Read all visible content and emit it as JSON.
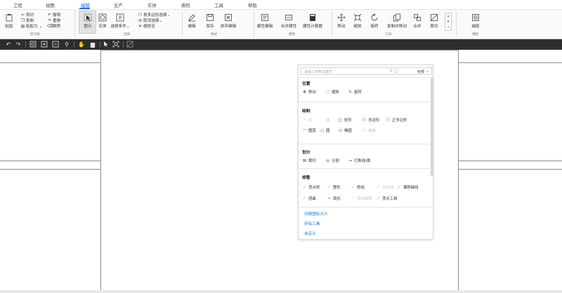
{
  "menubar": {
    "items": [
      {
        "label": "工程"
      },
      {
        "label": "视图"
      },
      {
        "label": "编辑"
      },
      {
        "label": "生产"
      },
      {
        "label": "实体"
      },
      {
        "label": "质检"
      },
      {
        "label": "工具"
      },
      {
        "label": "帮助"
      }
    ],
    "active_index": 2,
    "accent": "#1a73d9"
  },
  "ribbon": {
    "clipboard": {
      "paste": "粘贴",
      "cut": "剪切",
      "copy": "复制",
      "paste_to": "粘贴为",
      "undo": "撤销",
      "redo": "重做",
      "delete": "删除",
      "group_label": "剪切板"
    },
    "select": {
      "element": "图元",
      "entity": "实体",
      "select_condition": "选择条件",
      "poly_select": "按多边形选择",
      "cancel_select": "取消选择",
      "zoom_to": "缩放至",
      "group_label": "选择"
    },
    "style": {
      "edit": "编辑",
      "save": "保存",
      "discard": "放弃编辑",
      "group_label": "样式"
    },
    "attribute": {
      "attr_edit": "属性编辑",
      "merge_attr": "合并属性",
      "attr_calc": "属性计算器",
      "group_label": "属性"
    },
    "tools": {
      "move": "移动",
      "zoom": "缩放",
      "rotate": "旋转",
      "copy_move": "复制并移动",
      "merge": "合并",
      "crop": "裁切",
      "group_label": "工具"
    },
    "capture": {
      "snap": "捕捉",
      "group_label": "捕捉"
    }
  },
  "panel": {
    "search_placeholder": "请输入搜索关键字",
    "filter_value": "全部",
    "sections": {
      "position": {
        "title": "位置",
        "tools": [
          "移动",
          "缩放",
          "旋转"
        ]
      },
      "draw": {
        "title": "绘制",
        "row1": [
          "点",
          "线",
          "矩形",
          "多边形",
          "正多边形"
        ],
        "row2": [
          "圆弧",
          "圆",
          "椭圆",
          "曲线"
        ]
      },
      "split": {
        "title": "划分",
        "tools": [
          "裁切",
          "分割",
          "打断线/面"
        ]
      },
      "modify": {
        "title": "修整",
        "row1": [
          "顶点修",
          "整形",
          "修线",
          "平行线",
          "偏移曲线"
        ],
        "row2": [
          "扭曲",
          "简化",
          "闭合曲线",
          "顶点工具"
        ]
      }
    },
    "links": [
      "切换图标大小",
      "所有工具",
      "自定义"
    ]
  }
}
